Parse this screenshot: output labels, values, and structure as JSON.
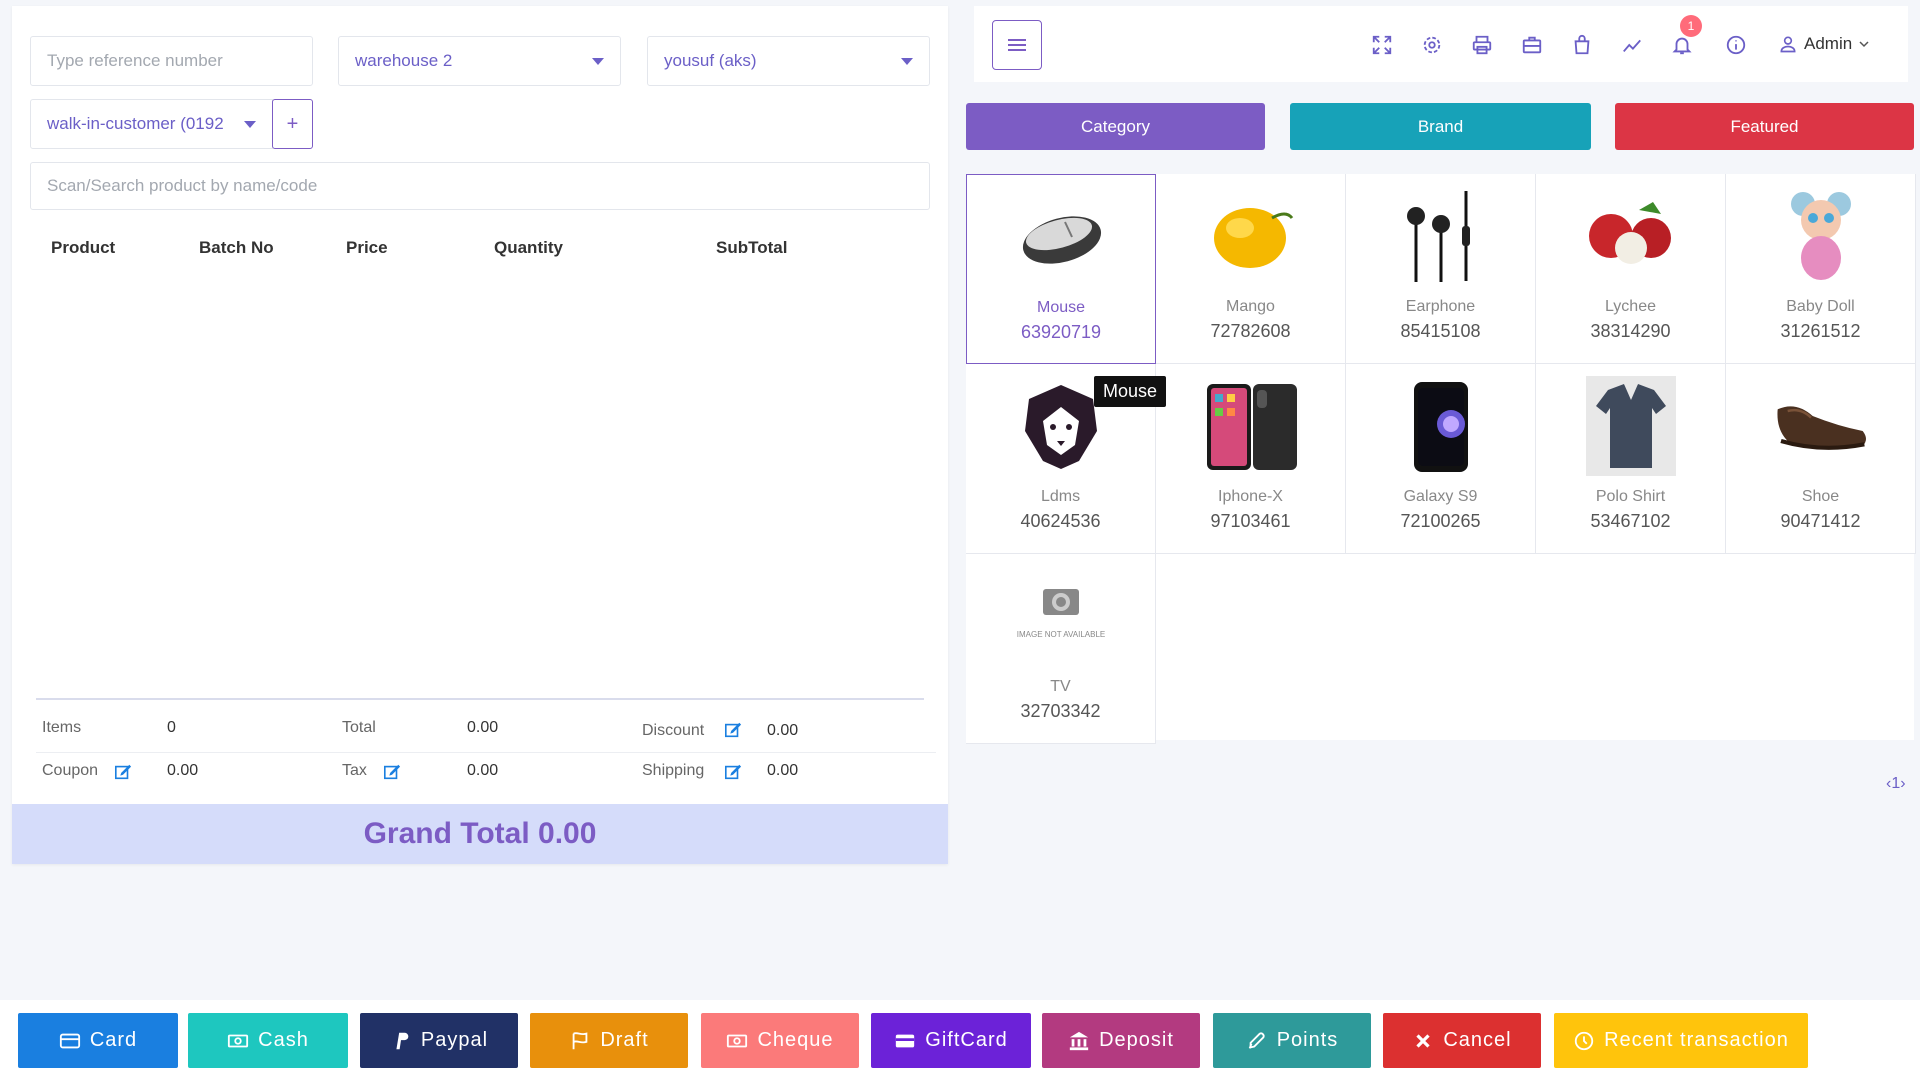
{
  "form": {
    "reference_placeholder": "Type reference number",
    "warehouse": "warehouse 2",
    "biller": "yousuf (aks)",
    "customer": "walk-in-customer (0192",
    "add_label": "+",
    "search_placeholder": "Scan/Search product by name/code"
  },
  "table": {
    "headers": [
      "Product",
      "Batch No",
      "Price",
      "Quantity",
      "SubTotal"
    ]
  },
  "summary": {
    "items_label": "Items",
    "items_value": "0",
    "total_label": "Total",
    "total_value": "0.00",
    "discount_label": "Discount",
    "discount_value": "0.00",
    "coupon_label": "Coupon",
    "coupon_value": "0.00",
    "tax_label": "Tax",
    "tax_value": "0.00",
    "shipping_label": "Shipping",
    "shipping_value": "0.00",
    "grand_total": "Grand Total 0.00"
  },
  "header": {
    "notification_count": "1",
    "user": "Admin"
  },
  "filters": {
    "category": "Category",
    "brand": "Brand",
    "featured": "Featured",
    "colors": {
      "category": "#7c5cc4",
      "brand": "#17a2b8",
      "featured": "#dc3545"
    }
  },
  "products": [
    {
      "name": "Mouse",
      "code": "63920719",
      "icon": "mouse-image"
    },
    {
      "name": "Mango",
      "code": "72782608",
      "icon": "mango-image"
    },
    {
      "name": "Earphone",
      "code": "85415108",
      "icon": "earphone-image"
    },
    {
      "name": "Lychee",
      "code": "38314290",
      "icon": "lychee-image"
    },
    {
      "name": "Baby Doll",
      "code": "31261512",
      "icon": "baby-doll-image"
    },
    {
      "name": "Ldms",
      "code": "40624536",
      "icon": "lion-logo-image"
    },
    {
      "name": "Iphone-X",
      "code": "97103461",
      "icon": "iphone-image"
    },
    {
      "name": "Galaxy S9",
      "code": "72100265",
      "icon": "galaxy-phone-image"
    },
    {
      "name": "Polo Shirt",
      "code": "53467102",
      "icon": "polo-shirt-image"
    },
    {
      "name": "Shoe",
      "code": "90471412",
      "icon": "shoe-image"
    },
    {
      "name": "TV",
      "code": "32703342",
      "icon": "image-not-available"
    }
  ],
  "image_not_available": "IMAGE NOT AVAILABLE",
  "tooltip": "Mouse",
  "pager": "‹1›",
  "payments": [
    {
      "label": "Card",
      "color": "#1a7fe0"
    },
    {
      "label": "Cash",
      "color": "#1ec7bf"
    },
    {
      "label": "Paypal",
      "color": "#213166"
    },
    {
      "label": "Draft",
      "color": "#e8900c"
    },
    {
      "label": "Cheque",
      "color": "#fb7a7a"
    },
    {
      "label": "GiftCard",
      "color": "#6c22d8"
    },
    {
      "label": "Deposit",
      "color": "#b33a80"
    },
    {
      "label": "Points",
      "color": "#2e9a9a"
    },
    {
      "label": "Cancel",
      "color": "#dc3030"
    },
    {
      "label": "Recent transaction",
      "color": "#ffc40c"
    }
  ]
}
